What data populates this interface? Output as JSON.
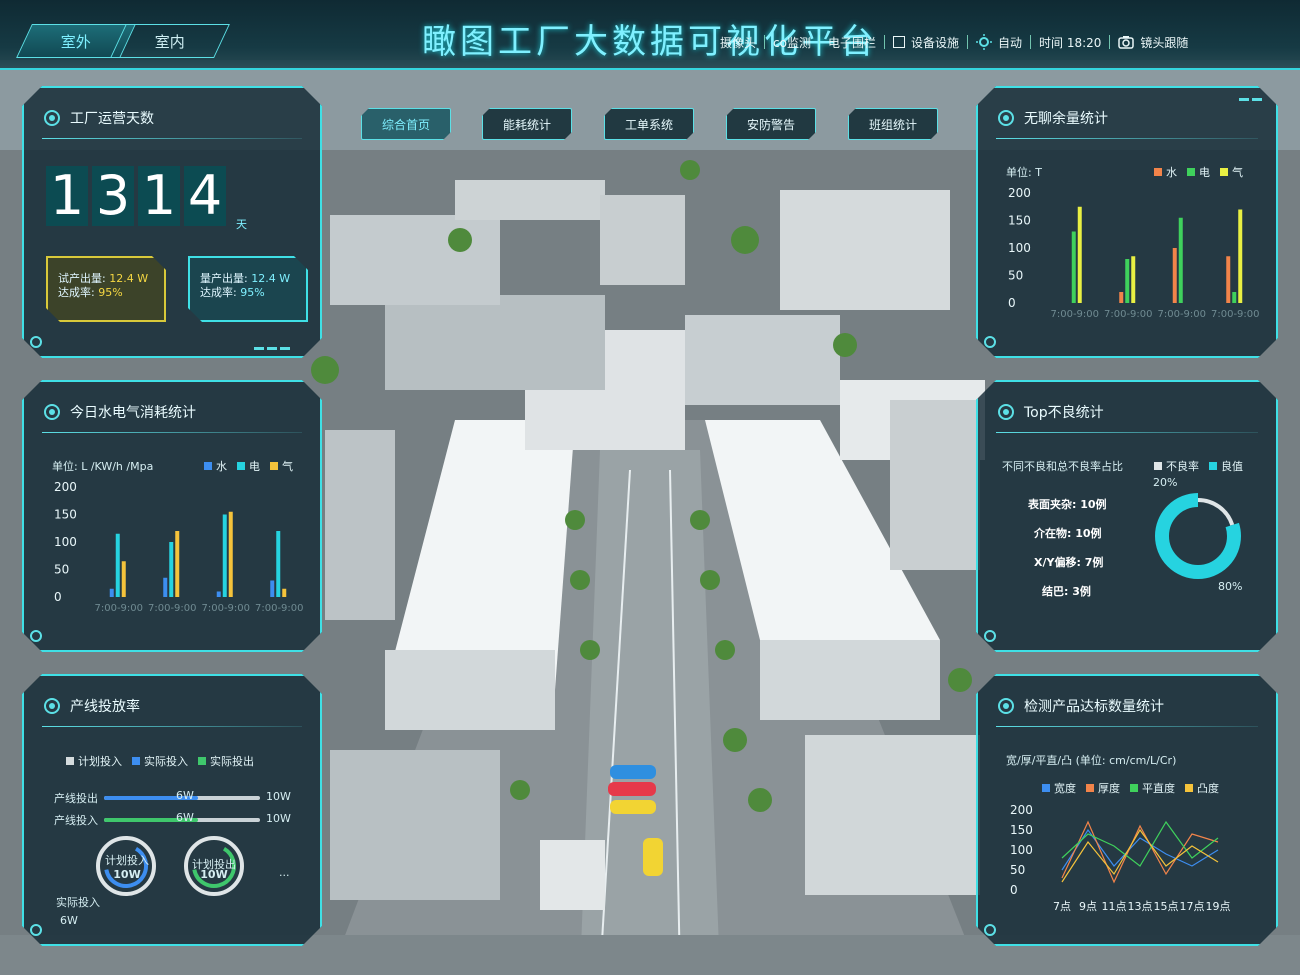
{
  "header": {
    "title": "瞰图工厂大数据可视化平台",
    "tabs": [
      {
        "label": "室外",
        "active": true
      },
      {
        "label": "室内",
        "active": false
      }
    ],
    "right_items": [
      "摄像头",
      "co监测",
      "电子围栏"
    ],
    "device_label": "设备设施",
    "auto_label": "自动",
    "time_label": "时间 18:20",
    "camera_label": "镜头跟随"
  },
  "nav": [
    {
      "label": "综合首页",
      "active": true
    },
    {
      "label": "能耗统计",
      "active": false
    },
    {
      "label": "工单系统",
      "active": false
    },
    {
      "label": "安防警告",
      "active": false
    },
    {
      "label": "班组统计",
      "active": false
    }
  ],
  "panels": {
    "days": {
      "title": "工厂运营天数",
      "digits": [
        "1",
        "3",
        "1",
        "4"
      ],
      "unit": "天",
      "trial": {
        "label": "试产出量:",
        "value": "12.4 W",
        "rate_label": "达成率:",
        "rate": "95%"
      },
      "mass": {
        "label": "量产出量:",
        "value": "12.4 W",
        "rate_label": "达成率:",
        "rate": "95%"
      }
    },
    "energy": {
      "title": "今日水电气消耗统计",
      "unit": "单位: L /KW/h /Mpa",
      "legend": [
        "水",
        "电",
        "气"
      ]
    },
    "input_rate": {
      "title": "产线投放率",
      "legend": [
        "计划投入",
        "实际投入",
        "实际投出"
      ],
      "rows": [
        {
          "label": "产线投出",
          "value": "6W",
          "max": "10W",
          "fill": 0.6
        },
        {
          "label": "产线投入",
          "value": "6W",
          "max": "10W",
          "fill": 0.6
        }
      ],
      "gauges": [
        {
          "label": "计划投入",
          "value": "10W"
        },
        {
          "label": "计划投出",
          "value": "10W"
        }
      ],
      "actual_label": "实际投入",
      "actual_value": "6W",
      "dots": "..."
    },
    "surplus": {
      "title": "无聊余量统计",
      "unit": "单位: T",
      "legend": [
        "水",
        "电",
        "气"
      ]
    },
    "defects": {
      "title": "Top不良统计",
      "subtitle": "不同不良和总不良率占比",
      "legend": [
        "不良率",
        "良值"
      ],
      "items": [
        "表面夹杂: 10例",
        "介在物: 10例",
        "X/Y偏移: 7例",
        "结巴: 3例"
      ],
      "pct_low": "20%",
      "pct_high": "80%"
    },
    "quality": {
      "title": "检测产品达标数量统计",
      "subtitle": "宽/厚/平直/凸 (单位: cm/cm/L/Cr)",
      "legend": [
        "宽度",
        "厚度",
        "平直度",
        "凸度"
      ]
    }
  },
  "colors": {
    "accent": "#3fe0e6",
    "water": "#3d8ef0",
    "power": "#26d3e0",
    "gas": "#f5c33b"
  },
  "chart_data": [
    {
      "type": "bar",
      "title": "今日水电气消耗统计",
      "categories": [
        "7:00-9:00",
        "7:00-9:00",
        "7:00-9:00",
        "7:00-9:00"
      ],
      "ylim": [
        0,
        200
      ],
      "yticks": [
        0,
        50,
        100,
        150,
        200
      ],
      "series": [
        {
          "name": "水",
          "values": [
            15,
            35,
            10,
            30
          ]
        },
        {
          "name": "电",
          "values": [
            115,
            100,
            150,
            120
          ]
        },
        {
          "name": "气",
          "values": [
            65,
            120,
            155,
            15
          ]
        }
      ]
    },
    {
      "type": "bar",
      "title": "无聊余量统计",
      "categories": [
        "7:00-9:00",
        "7:00-9:00",
        "7:00-9:00",
        "7:00-9:00"
      ],
      "ylim": [
        0,
        200
      ],
      "yticks": [
        0,
        50,
        100,
        150,
        200
      ],
      "series": [
        {
          "name": "水",
          "values": [
            0,
            20,
            100,
            85
          ]
        },
        {
          "name": "电",
          "values": [
            130,
            80,
            155,
            20
          ]
        },
        {
          "name": "气",
          "values": [
            175,
            85,
            0,
            170
          ]
        }
      ]
    },
    {
      "type": "pie",
      "title": "Top不良统计",
      "slices": [
        {
          "name": "不良率",
          "value": 20
        },
        {
          "name": "良值",
          "value": 80
        }
      ]
    },
    {
      "type": "line",
      "title": "检测产品达标数量统计",
      "x": [
        "7点",
        "9点",
        "11点",
        "13点",
        "15点",
        "17点",
        "19点"
      ],
      "ylim": [
        0,
        200
      ],
      "yticks": [
        0,
        50,
        100,
        150,
        200
      ],
      "series": [
        {
          "name": "宽度",
          "values": [
            50,
            150,
            60,
            130,
            90,
            60,
            100
          ]
        },
        {
          "name": "厚度",
          "values": [
            30,
            170,
            20,
            160,
            40,
            140,
            120
          ]
        },
        {
          "name": "平直度",
          "values": [
            80,
            140,
            110,
            60,
            170,
            80,
            130
          ]
        },
        {
          "name": "凸度",
          "values": [
            20,
            120,
            40,
            150,
            60,
            110,
            70
          ]
        }
      ]
    }
  ]
}
